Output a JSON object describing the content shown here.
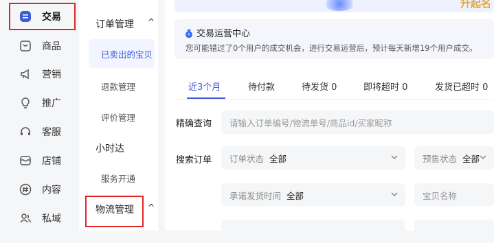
{
  "rail": {
    "items": [
      {
        "label": "交易",
        "icon": "trade-icon",
        "active": true
      },
      {
        "label": "商品",
        "icon": "goods-icon"
      },
      {
        "label": "营销",
        "icon": "megaphone-icon"
      },
      {
        "label": "推广",
        "icon": "lightbulb-icon"
      },
      {
        "label": "客服",
        "icon": "headset-icon"
      },
      {
        "label": "店铺",
        "icon": "store-icon"
      },
      {
        "label": "内容",
        "icon": "hashtag-icon"
      },
      {
        "label": "私域",
        "icon": "users-icon"
      }
    ]
  },
  "submenu": {
    "group1": {
      "label": "订单管理",
      "caret": "^"
    },
    "items1": [
      "已卖出的宝贝",
      "退款管理",
      "评价管理"
    ],
    "group2": {
      "label": "小时达"
    },
    "items2": [
      "服务开通"
    ],
    "group3": {
      "label": "物流管理",
      "caret": "^"
    }
  },
  "banner": {
    "text": "升起名"
  },
  "notice": {
    "title": "交易运营中心",
    "desc": "您可能错过了0个用户的成交机会，进行交易运营后，预计每天新增19个用户成交。"
  },
  "tabs": [
    "近3个月",
    "待付款",
    "待发货 0",
    "即将超时 0",
    "发货已超时 0"
  ],
  "search": {
    "exact_label": "精确查询",
    "exact_placeholder": "请输入订单编号/物流单号/商品id/买家昵称",
    "search_label": "搜索订单",
    "order_status_key": "订单状态",
    "order_status_val": "全部",
    "presale_key": "预售状态",
    "presale_val": "全部",
    "promise_key": "承诺发货时间",
    "promise_val": "全部",
    "item_name_placeholder": "宝贝名称"
  },
  "colors": {
    "accent": "#3b5bdb",
    "highlight": "#e02424"
  }
}
